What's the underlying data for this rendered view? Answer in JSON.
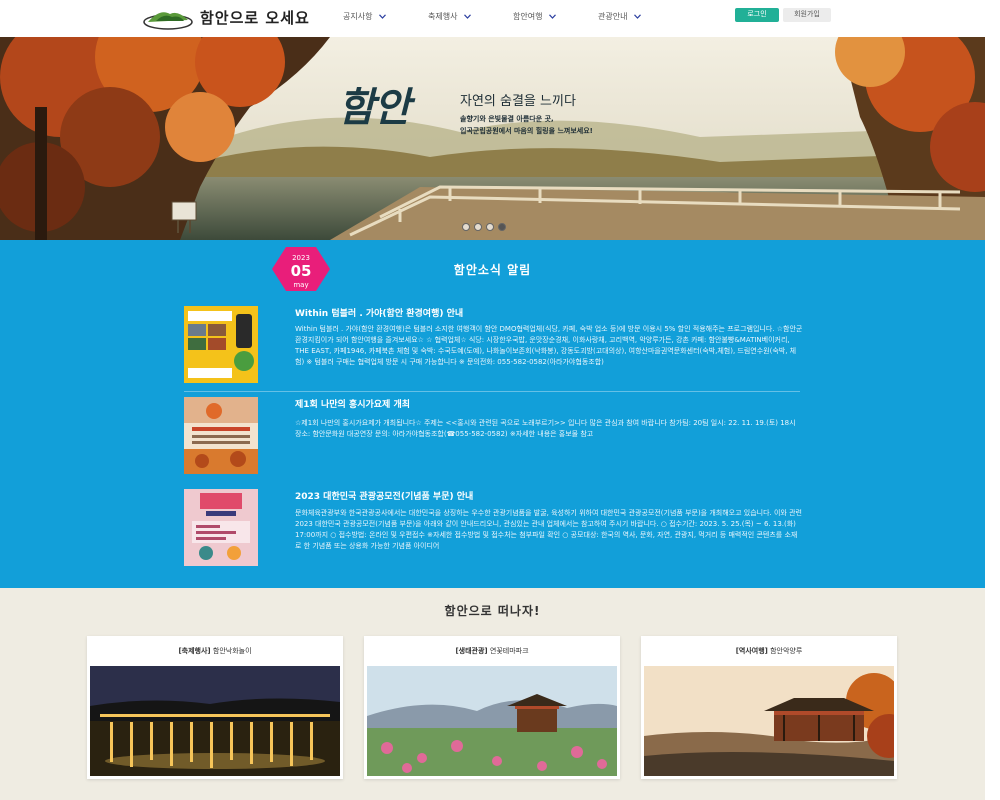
{
  "header": {
    "logo_text": "함안으로 오세요",
    "nav": [
      {
        "label": "공지사항"
      },
      {
        "label": "축제행사"
      },
      {
        "label": "함안여행"
      },
      {
        "label": "관광안내"
      }
    ],
    "login_label": "로그인",
    "join_label": "회원가입"
  },
  "hero": {
    "title": "함안",
    "subtitle": "자연의 숨결을 느끼다",
    "desc_line1": "솔향기와 은빛물결 아름다운 곳,",
    "desc_line2": "입곡군립공원에서 마음의 힐링을 느껴보세요!",
    "slide_count": 4,
    "active_slide": 4
  },
  "news": {
    "badge": {
      "year": "2023",
      "day": "05",
      "month": "may"
    },
    "title": "함안소식 알림",
    "items": [
      {
        "title": "Within 텀블러 . 가야(함안 환경여행) 안내",
        "text": "Within 텀블러 . 가야(함안 환경여행)은 텀블러 소지한 여행객이 함안 DMO협력업체(식당, 카페, 숙박 업소 등)에 방문 이용시 5% 할인 적용해주는 프로그램입니다. ☆함안군 환경지킴이가 되어 함안여행을 즐겨보세요☆ ☆ 협력업체☆ 식당: 시장한우국밥, 운맛장순경채, 이화사랑채, 고리백역, 악양루가든, 강촌 카페: 함안불빵&MATIN베이커리, THE EAST, 카페1946, 카페북촌 체험 및 숙박: 수국도예(도예), 나화놀이보존회(낙화봉), 강동도괴방(고대의상), 여항산마을권역문화센터(숙박,체험), 드림연수원(숙박, 체험) ※ 텀블러 구매는 협력업체 방문 시 구매 가능합니다 ※ 문의전화: 055-582-0582(아라가야협동조합)"
      },
      {
        "title": "제1회 나만의 홍시가요제 개최",
        "text": "☆제1회 나만의 홍시가요제가 개최됩니다☆ 주제는 <<홍시와 관련된 곡으로 노래부르기>> 입니다 많은 관심과 참여 바랍니다 참가팀: 20팀 일시: 22. 11. 19.(토) 18시 장소: 함안문화원 대공연장 문의: 아라가야협동조합(☎055-582-0582) ※자세한 내용은 홍보물 참고"
      },
      {
        "title": "2023 대한민국 관광공모전(기념품 부문) 안내",
        "text": "문화체육관광부와 한국관광공사에서는 대한민국을 상징하는 우수한 관광기념품을 발굴, 육성하기 위하여 대한민국 관광공모전(기념품 부문)을 개최해오고 있습니다. 이와 관련 2023 대한민국 관광공모전(기념품 부문)을 아래와 같이 안내드리오니, 관심있는 관내 업체에서는 참고하여 주시기 바랍니다. ○ 접수기간: 2023. 5. 25.(목) ~ 6. 13.(화) 17:00까지 ○ 접수방법: 온라인 및 우편접수 ※자세한 접수방법 및 접수처는 첨부파일 확인 ○ 공모대상: 한국의 역사, 문화, 자연, 관광지, 먹거리 등 매력적인 콘텐츠를 소재로 한 기념품 또는 상용화 가능한 기념품 아이디어"
      }
    ]
  },
  "travel": {
    "title": "함안으로 떠나자!",
    "cards": [
      {
        "category": "[축제행사]",
        "name": "함안낙화놀이"
      },
      {
        "category": "[생태관광]",
        "name": "연꽃테마파크"
      },
      {
        "category": "[역사여행]",
        "name": "함안악양루"
      }
    ]
  },
  "colors": {
    "accent_green": "#21b097",
    "news_blue": "#129fd9",
    "badge_pink": "#e91e7a",
    "travel_bg": "#efece2"
  },
  "icons": [
    "logo-mountain-icon",
    "chevron-down-icon"
  ]
}
